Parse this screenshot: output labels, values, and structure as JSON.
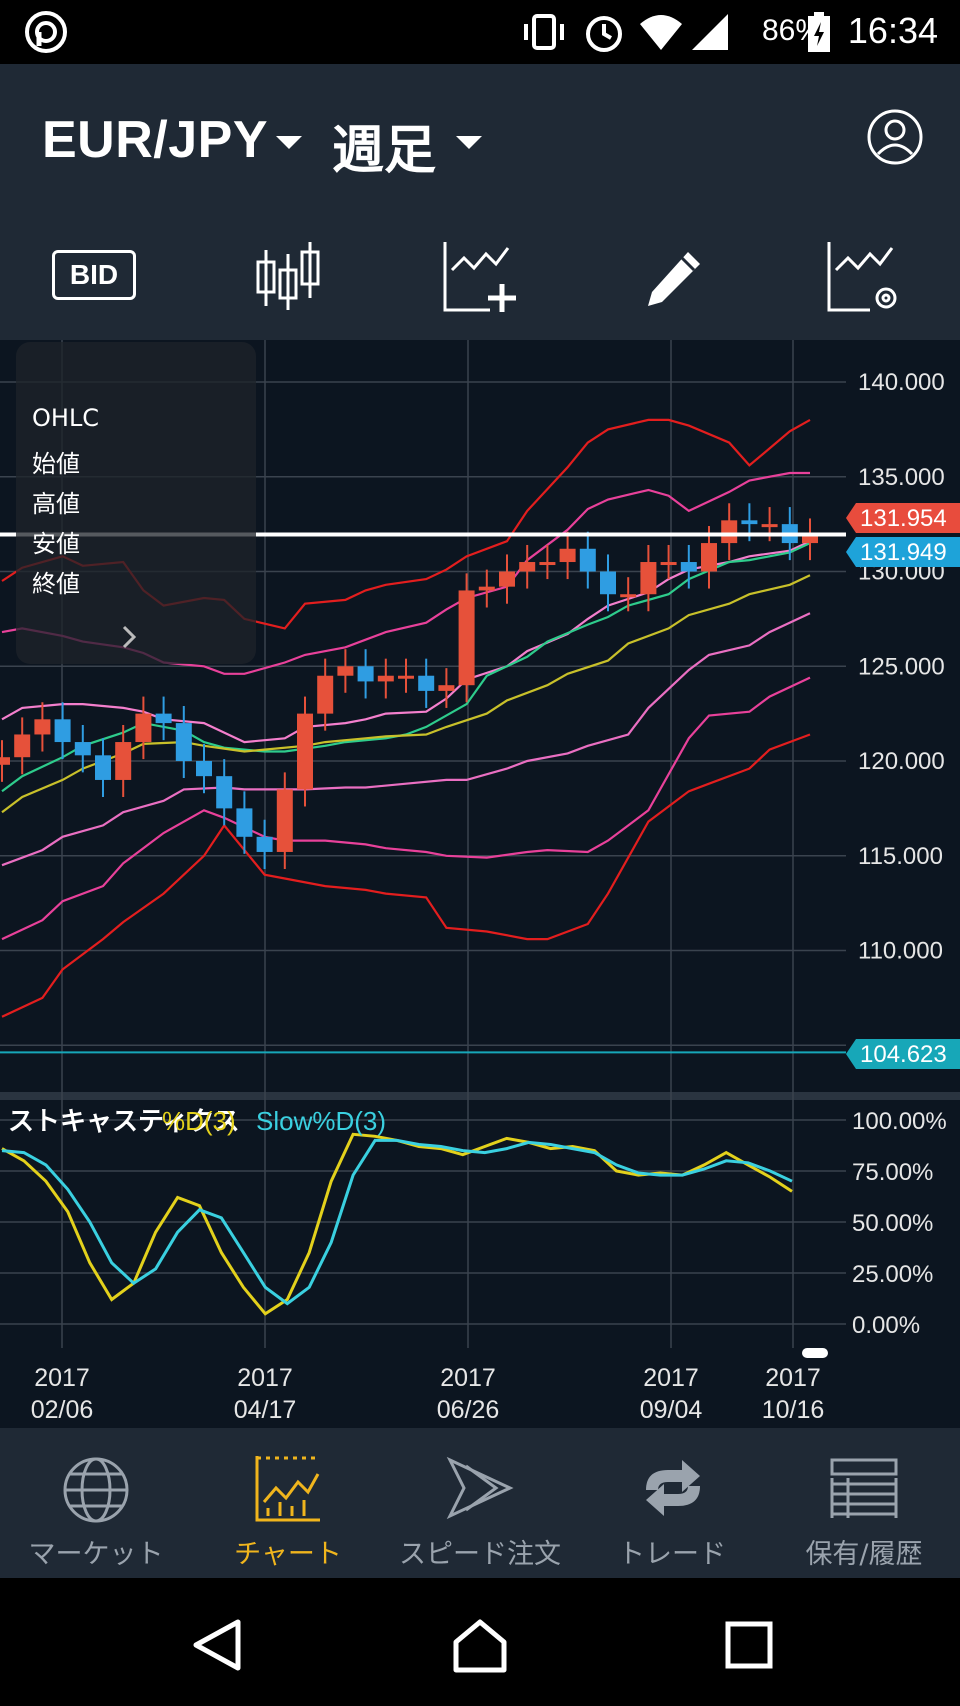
{
  "status_bar": {
    "battery": "86%",
    "time": "16:34"
  },
  "header": {
    "pair": "EUR/JPY",
    "period": "週足"
  },
  "toolbar": {
    "bid_label": "BID"
  },
  "ohlc_panel": {
    "title": "OHLC",
    "open": "始値",
    "high": "高値",
    "low": "安値",
    "close": "終値"
  },
  "price_axis": {
    "labels": [
      "140.000",
      "135.000",
      "131.954",
      "131.949",
      "130.000",
      "125.000",
      "120.000",
      "115.000",
      "110.000",
      "104.623"
    ],
    "ask_tag": "131.954",
    "bid_tag": "131.949",
    "low_tag": "104.623",
    "colors": {
      "ask": "#e84c3d",
      "bid": "#1ea3d9",
      "low": "#17a7b8"
    }
  },
  "stochastics": {
    "title": "ストキャスティクス",
    "d_label": "%D(3)",
    "slowd_label": "Slow%D(3)",
    "pct_labels": [
      "100.00%",
      "75.00%",
      "50.00%",
      "25.00%",
      "0.00%"
    ],
    "colors": {
      "d": "#e3d11c",
      "slowd": "#3ad0e0"
    }
  },
  "time_axis": {
    "labels": [
      {
        "year": "2017",
        "date": "02/06"
      },
      {
        "year": "2017",
        "date": "04/17"
      },
      {
        "year": "2017",
        "date": "06/26"
      },
      {
        "year": "2017",
        "date": "09/04"
      },
      {
        "year": "2017",
        "date": "10/16"
      }
    ]
  },
  "bottom_nav": {
    "items": [
      {
        "label": "マーケット",
        "icon": "globe-icon",
        "active": false
      },
      {
        "label": "チャート",
        "icon": "chart-icon",
        "active": true
      },
      {
        "label": "スピード注文",
        "icon": "speed-order-icon",
        "active": false
      },
      {
        "label": "トレード",
        "icon": "trade-icon",
        "active": false
      },
      {
        "label": "保有/履歴",
        "icon": "history-list-icon",
        "active": false
      }
    ]
  },
  "chart_data": {
    "type": "candlestick",
    "title": "",
    "series_close_approx": [
      120.2,
      121.4,
      122.2,
      121.0,
      120.3,
      119.0,
      121.0,
      122.5,
      122.0,
      120.0,
      119.2,
      117.5,
      116.0,
      115.2,
      118.5,
      122.5,
      124.5,
      125.0,
      124.2,
      124.5,
      124.5,
      123.7,
      124.0,
      129.0,
      129.2,
      130.0,
      130.5,
      130.5,
      131.2,
      130.0,
      128.8,
      128.8,
      130.5,
      130.5,
      130.0,
      131.5,
      132.7,
      132.5,
      132.5,
      131.5,
      131.9
    ],
    "ylim": [
      104.0,
      141.0
    ],
    "stochastic_ylim": [
      0,
      100
    ],
    "stochastic_d": [
      86,
      80,
      70,
      55,
      30,
      12,
      20,
      45,
      62,
      58,
      35,
      18,
      5,
      12,
      35,
      70,
      93,
      92,
      90,
      87,
      86,
      83,
      87,
      91,
      89,
      86,
      87,
      85,
      75,
      73,
      74,
      73,
      78,
      84,
      78,
      72,
      65
    ],
    "stochastic_slowd": [
      85,
      84,
      78,
      66,
      50,
      30,
      20,
      27,
      45,
      56,
      52,
      35,
      18,
      10,
      18,
      40,
      73,
      90,
      90,
      88,
      87,
      85,
      84,
      86,
      89,
      88,
      86,
      84,
      78,
      74,
      73,
      73,
      76,
      80,
      79,
      75,
      70
    ]
  }
}
